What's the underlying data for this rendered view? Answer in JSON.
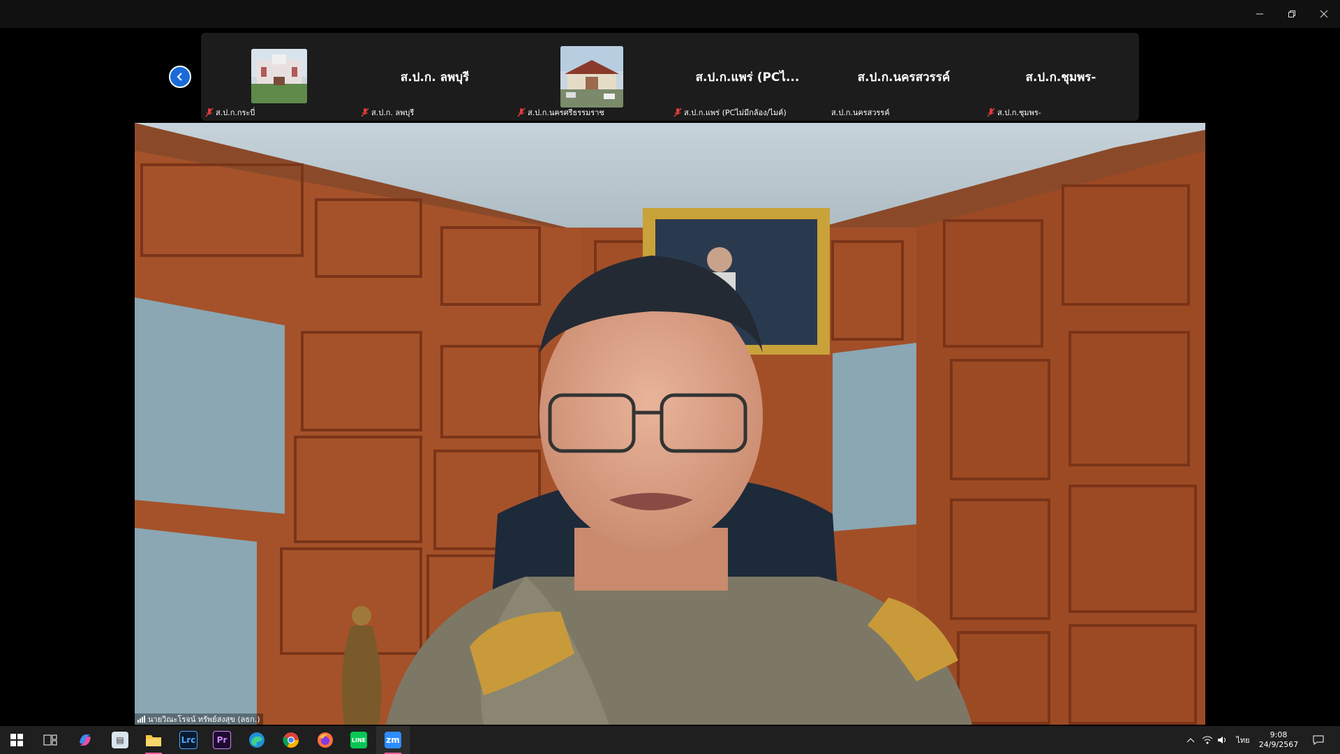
{
  "window": {
    "controls": [
      "minimize-icon",
      "restore-icon",
      "close-icon"
    ]
  },
  "gallery": {
    "prev_icon": "chevron-left-icon",
    "tiles": [
      {
        "label": "ส.ป.ก.กระบี่",
        "big_name": "",
        "thumb": "building-photo",
        "muted": true
      },
      {
        "label": "ส.ป.ก. ลพบุรี",
        "big_name": "ส.ป.ก. ลพบุรี",
        "thumb": "",
        "muted": true
      },
      {
        "label": "ส.ป.ก.นครศรีธรรมราช",
        "big_name": "",
        "thumb": "building-photo",
        "muted": true
      },
      {
        "label": "ส.ป.ก.แพร่ (PCไม่มีกล้อง/ไมค์)",
        "big_name": "ส.ป.ก.แพร่ (PCไ...",
        "thumb": "",
        "muted": true
      },
      {
        "label": "ส.ป.ก.นครสวรรค์",
        "big_name": "ส.ป.ก.นครสวรรค์",
        "thumb": "",
        "muted": false
      },
      {
        "label": "ส.ป.ก.ชุมพร-",
        "big_name": "ส.ป.ก.ชุมพร-",
        "thumb": "",
        "muted": true
      }
    ]
  },
  "active_speaker": {
    "name": "นายวิณะโรจน์ ทรัพย์สงสุข (ลธก.)",
    "signal_icon": "signal-bars-icon"
  },
  "taskbar": {
    "apps": [
      {
        "name": "start",
        "icon": "windows-icon",
        "active": false
      },
      {
        "name": "task-view",
        "icon": "task-view-icon",
        "active": false
      },
      {
        "name": "copilot",
        "icon": "copilot-icon",
        "active": false
      },
      {
        "name": "app",
        "icon": "app-icon",
        "active": false
      },
      {
        "name": "file-explorer",
        "icon": "folder-icon",
        "active": true
      },
      {
        "name": "lightroom",
        "icon": "lrc-icon",
        "text": "Lrc",
        "active": false
      },
      {
        "name": "premiere",
        "icon": "pr-icon",
        "text": "Pr",
        "active": false
      },
      {
        "name": "edge",
        "icon": "edge-icon",
        "active": false
      },
      {
        "name": "chrome",
        "icon": "chrome-icon",
        "active": false
      },
      {
        "name": "firefox",
        "icon": "firefox-icon",
        "active": false
      },
      {
        "name": "line",
        "icon": "line-icon",
        "text": "LINE",
        "active": false
      },
      {
        "name": "zoom",
        "icon": "zoom-icon",
        "text": "zm",
        "active": true
      }
    ],
    "tray": {
      "language": "ไทย",
      "time": "9:08",
      "date": "24/9/2567"
    }
  }
}
